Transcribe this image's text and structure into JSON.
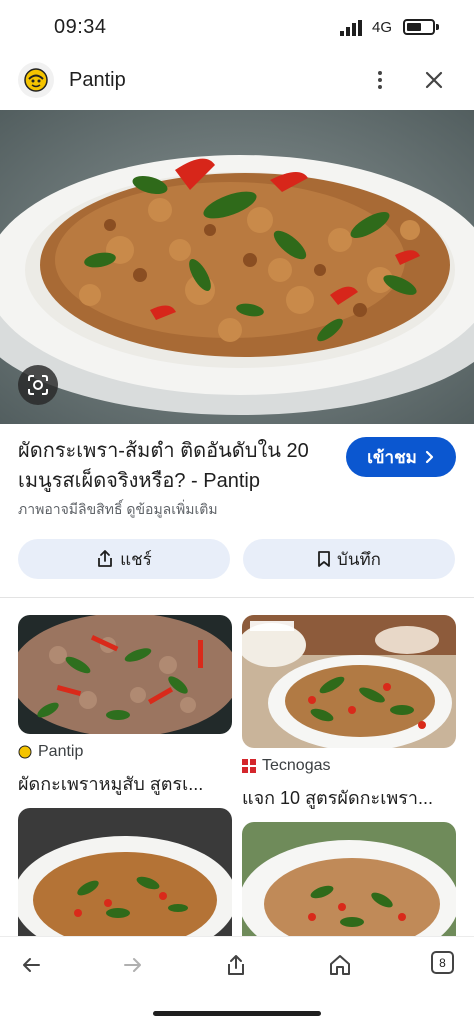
{
  "status_bar": {
    "time": "09:34",
    "network": "4G",
    "battery_level": 0.6
  },
  "app_bar": {
    "site_name": "Pantip",
    "logo_icon": "pantip-logo-icon",
    "more_icon": "more-vert-icon",
    "close_icon": "close-icon"
  },
  "hero": {
    "lens_icon": "google-lens-icon"
  },
  "result": {
    "title": "ผัดกระเพรา-ส้มตำ ติดอันดับใน 20 เมนูรสเผ็ดจริงหรือ? - Pantip",
    "visit_label": "เข้าชม",
    "copyright_notice": "ภาพอาจมีลิขสิทธิ์ ดูข้อมูลเพิ่มเติม"
  },
  "actions": {
    "share_label": "แชร์",
    "save_label": "บันทึก"
  },
  "related": [
    {
      "source": "Pantip",
      "caption": "ผัดกะเพราหมูสับ สูตรเ..."
    },
    {
      "source": "Tecnogas",
      "caption": "แจก 10 สูตรผัดกะเพรา..."
    },
    {
      "source": "",
      "caption": ""
    },
    {
      "source": "",
      "caption": ""
    }
  ],
  "bottom_nav": {
    "tab_count": "8"
  },
  "colors": {
    "accent": "#0b57d0",
    "chip_bg": "#e8eef9",
    "text": "#1f1f1f",
    "muted": "#5f6368"
  }
}
